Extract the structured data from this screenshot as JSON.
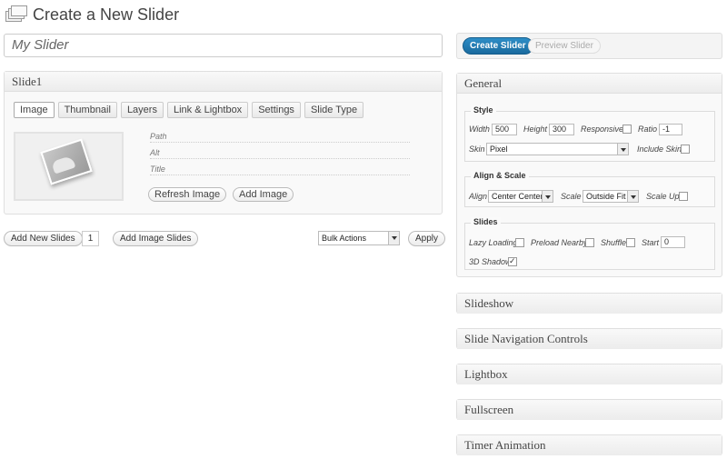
{
  "header": {
    "title": "Create a New Slider"
  },
  "title_input": {
    "value": "My Slider"
  },
  "slide": {
    "heading": "Slide1",
    "tabs": [
      "Image",
      "Thumbnail",
      "Layers",
      "Link & Lightbox",
      "Settings",
      "Slide Type"
    ],
    "fields": {
      "path": "Path",
      "alt": "Alt",
      "title": "Title"
    },
    "refresh_label": "Refresh Image",
    "add_label": "Add Image"
  },
  "bottom": {
    "add_new_slides": "Add New Slides",
    "count": "1",
    "add_image_slides": "Add Image Slides",
    "bulk_actions": "Bulk Actions",
    "apply": "Apply"
  },
  "toolbar": {
    "create": "Create Slider",
    "preview": "Preview Slider"
  },
  "general": {
    "heading": "General",
    "style": {
      "legend": "Style",
      "width_label": "Width",
      "width_value": "500",
      "height_label": "Height",
      "height_value": "300",
      "responsive_label": "Responsive",
      "ratio_label": "Ratio",
      "ratio_value": "-1",
      "skin_label": "Skin",
      "skin_value": "Pixel",
      "include_skin_label": "Include Skin"
    },
    "align": {
      "legend": "Align & Scale",
      "align_label": "Align",
      "align_value": "Center Center",
      "scale_label": "Scale",
      "scale_value": "Outside Fit",
      "scale_up_label": "Scale Up"
    },
    "slides": {
      "legend": "Slides",
      "lazy_label": "Lazy Loading",
      "preload_label": "Preload Nearby",
      "shuffle_label": "Shuffle",
      "start_label": "Start",
      "start_value": "0",
      "shadow_label": "3D Shadow"
    }
  },
  "sections": [
    "Slideshow",
    "Slide Navigation Controls",
    "Lightbox",
    "Fullscreen",
    "Timer Animation"
  ]
}
